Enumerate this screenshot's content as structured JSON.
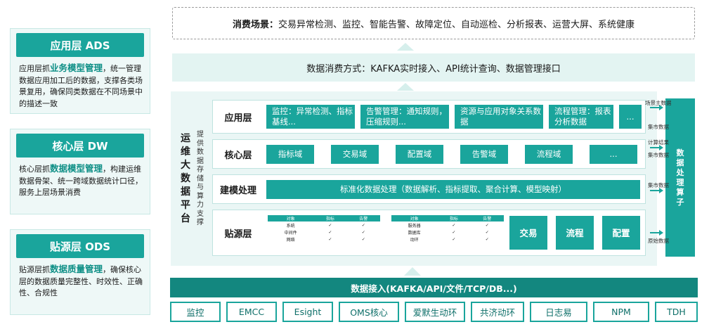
{
  "left_layers": [
    {
      "title": "应用层 ADS",
      "desc_pre": "应用层抓",
      "desc_key": "业务模型管理",
      "desc_post": "，统一管理数据应用加工后的数据，支撑各类场景复用，确保同类数据在不同场景中的描述一致"
    },
    {
      "title": "核心层 DW",
      "desc_pre": "核心层抓",
      "desc_key": "数据模型管理",
      "desc_post": "，构建运维数据骨架、统一跨域数据统计口径，服务上层场景消费"
    },
    {
      "title": "贴源层 ODS",
      "desc_pre": "贴源层抓",
      "desc_key": "数据质量管理",
      "desc_post": "，确保核心层的数据质量完整性、时效性、正确性、合规性"
    }
  ],
  "scenario": {
    "label": "消费场景：",
    "text": "交易异常检测、监控、智能告警、故障定位、自动巡检、分析报表、运营大屏、系统健康"
  },
  "consume": "数据消费方式：KAFKA实时接入、API统计查询、数据管理接口",
  "platform": {
    "title": "运维大数据平台",
    "subtitle": "提供数据存储与算力支撑"
  },
  "app_row": {
    "label": "应用层",
    "items": [
      "监控：异常检测、指标基线...",
      "告警管理：通知规则，压缩规则...",
      "资源与应用对象关系数据",
      "流程管理：报表分析数据",
      "..."
    ]
  },
  "core_row": {
    "label": "核心层",
    "items": [
      "指标域",
      "交易域",
      "配置域",
      "告警域",
      "流程域",
      "..."
    ]
  },
  "model_row": {
    "label": "建模处理",
    "text": "标准化数据处理（数据解析、指标提取、聚合计算、模型映射）"
  },
  "ods_row": {
    "label": "贴源层",
    "table1": {
      "headers": [
        "对象",
        "指标",
        "告警"
      ],
      "rows": [
        [
          "系统",
          "✓",
          "✓"
        ],
        [
          "中间件",
          "✓",
          "✓"
        ],
        [
          "网络",
          "✓",
          "✓"
        ]
      ]
    },
    "table2": {
      "headers": [
        "对象",
        "指标",
        "告警"
      ],
      "rows": [
        [
          "服务器",
          "✓",
          "✓"
        ],
        [
          "数据库",
          "✓",
          "✓"
        ],
        [
          "动环",
          "✓",
          "✓"
        ]
      ]
    },
    "boxes": [
      "交易",
      "流程",
      "配置"
    ]
  },
  "side_bar": "数据处理算子",
  "side_labels": [
    "场景主数据",
    "集市数据",
    "计算结果",
    "集市数据",
    "集市数据",
    "原始数据"
  ],
  "ingest": "数据接入(KAFKA/API/文件/TCP/DB...)",
  "sources": [
    "监控",
    "EMCC",
    "Esight",
    "OMS核心",
    "爱默生动环",
    "共济动环",
    "日志易",
    "NPM",
    "TDH"
  ]
}
